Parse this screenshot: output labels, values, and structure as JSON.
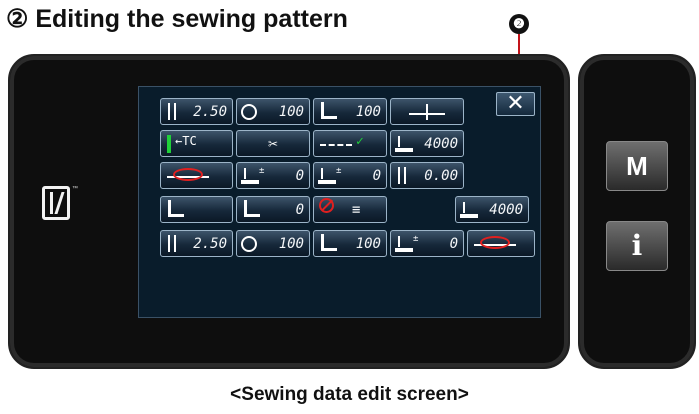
{
  "heading": "② Editing the sewing pattern",
  "callout_number": "❷",
  "close_label": "✕",
  "side_buttons": {
    "m": "M",
    "info": "i"
  },
  "nfc_trademark": "™",
  "caption": "<Sewing data edit screen>",
  "rows": [
    [
      {
        "icon": "stitch-pitch-icon",
        "value": "2.50"
      },
      {
        "icon": "thread-tension-icon",
        "value": "100"
      },
      {
        "icon": "presser-foot-pressure-icon",
        "value": "100"
      },
      {
        "icon": "needle-stitch-icon",
        "value": ""
      }
    ],
    [
      {
        "icon": "thread-clamp-tc-icon",
        "value": "TC"
      },
      {
        "icon": "thread-trimmer-icon",
        "value": "✂"
      },
      {
        "icon": "stitch-pattern-icon",
        "value": ""
      },
      {
        "icon": "stitch-counter-icon",
        "value": "4000"
      }
    ],
    [
      {
        "icon": "start-bartack-icon",
        "value": ""
      },
      {
        "icon": "feed-adjust-a-icon",
        "value": "0"
      },
      {
        "icon": "feed-adjust-b-icon",
        "value": "0"
      },
      {
        "icon": "stitch-pitch-adjust-icon",
        "value": "0.00"
      }
    ],
    [
      {
        "icon": "alternating-height-icon",
        "value": ""
      },
      {
        "icon": "alternating-vertical-icon",
        "value": "0"
      },
      {
        "icon": "tension-off-menu-icon",
        "value": "≡"
      },
      {
        "icon": "sub-counter-icon",
        "value": "4000"
      }
    ],
    [
      {
        "icon": "sub-stitch-pitch-icon",
        "value": "2.50"
      },
      {
        "icon": "sub-thread-tension-icon",
        "value": "100"
      },
      {
        "icon": "sub-presser-pressure-icon",
        "value": "100"
      },
      {
        "icon": "sub-feed-adjust-icon",
        "value": "0"
      },
      {
        "icon": "sub-bartack-icon",
        "value": ""
      }
    ]
  ]
}
